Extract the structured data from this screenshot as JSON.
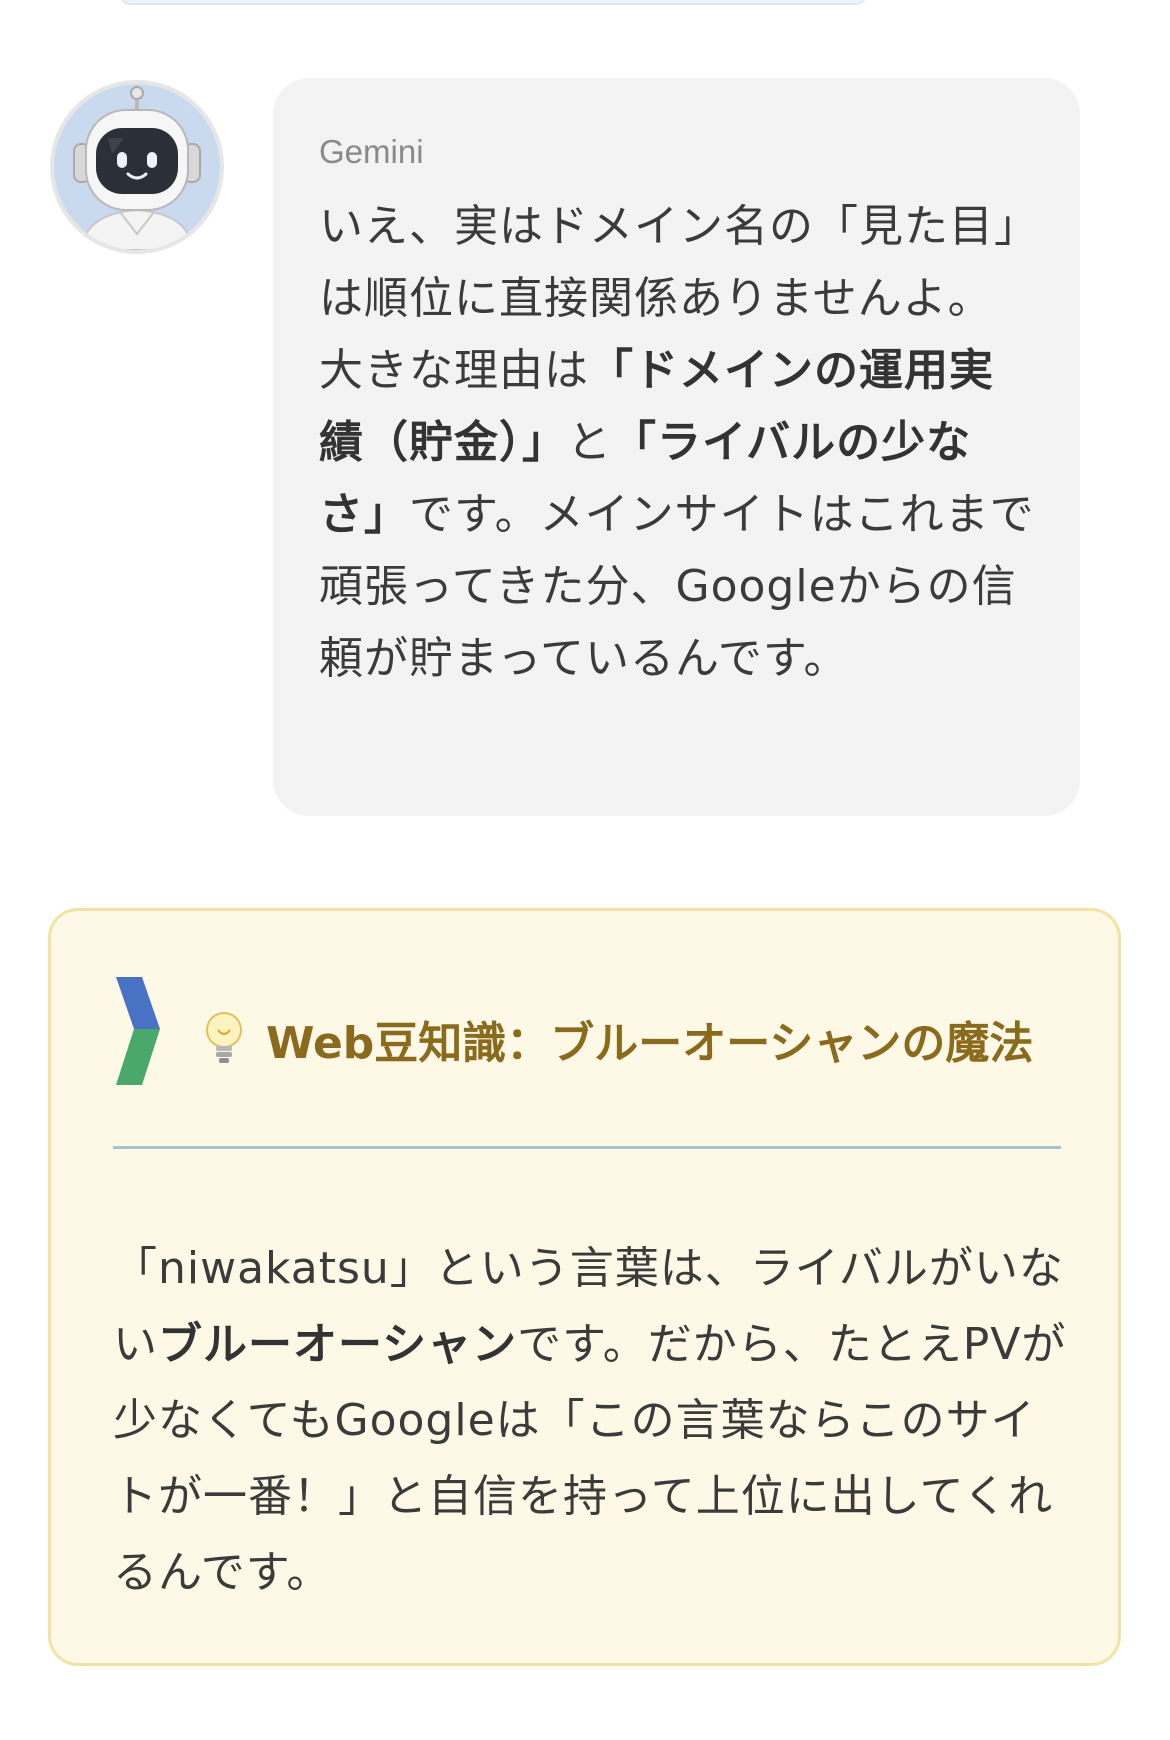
{
  "chat": {
    "speaker": "Gemini",
    "avatar_icon": "robot-avatar-icon",
    "message": {
      "p1": "いえ、実はドメイン名の「見た目」は順位に直接関係ありませんよ。",
      "p2a": "大きな理由は",
      "p2b": "「ドメインの運用実績（貯金）」",
      "p2c": "と",
      "p2d": "「ライバルの少なさ」",
      "p2e": "です。メインサイトはこれまで頑張ってきた分、Googleからの信頼が貯まっているんです。"
    }
  },
  "trivia": {
    "icon": "lightbulb-icon",
    "chevron_icon": "chevron-icon",
    "title": "Web豆知識：ブルーオーシャンの魔法",
    "body": {
      "a": "「niwakatsu」という言葉は、ライバルがいない",
      "b": "ブルーオーシャン",
      "c": "です。だから、たとえPVが少なくてもGoogleは「この言葉ならこのサイトが一番！」と自信を持って上位に出してくれるんです。"
    },
    "colors": {
      "background": "#fdf9e6",
      "border": "#f2e3a2",
      "title": "#8a6a1c",
      "chevron_blue": "#4a72c4",
      "chevron_green": "#4aa86a"
    }
  }
}
